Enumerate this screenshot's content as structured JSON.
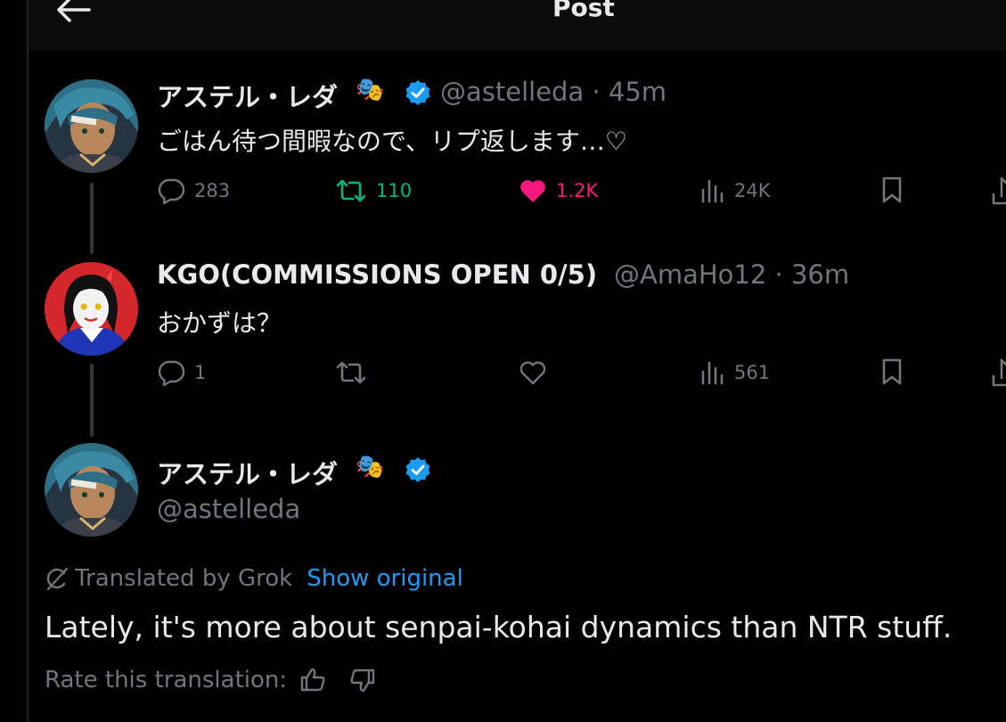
{
  "header": {
    "title": "Post"
  },
  "posts": [
    {
      "name": "アステル・レダ",
      "handle": "@astelleda",
      "time": "45m",
      "text": "ごはん待つ間暇なので、リプ返します…♡",
      "replies": "283",
      "reposts": "110",
      "likes": "1.2K",
      "views": "24K"
    },
    {
      "name": "KGO(COMMISSIONS OPEN 0/5)",
      "handle": "@AmaHo12",
      "time": "36m",
      "text": "おかずは？",
      "replies": "1",
      "views": "561"
    }
  ],
  "main_post": {
    "name": "アステル・レダ",
    "handle": "@astelleda",
    "translated_by": "Translated by Grok",
    "show_original": "Show original",
    "text": "Lately, it's more about senpai-kohai dynamics than NTR stuff.",
    "rate_label": "Rate this translation:"
  },
  "colors": {
    "background": "#000000",
    "muted": "#71767b",
    "link": "#1d9bf0",
    "repost_active": "#00ba7c",
    "like_active": "#f91880",
    "verified": "#1d9bf0"
  },
  "icons": [
    "back-arrow-icon",
    "verified-badge-icon",
    "theater-masks-icon",
    "reply-icon",
    "repost-icon",
    "like-icon",
    "views-icon",
    "bookmark-icon",
    "share-icon",
    "grok-icon",
    "thumbs-up-icon",
    "thumbs-down-icon"
  ]
}
